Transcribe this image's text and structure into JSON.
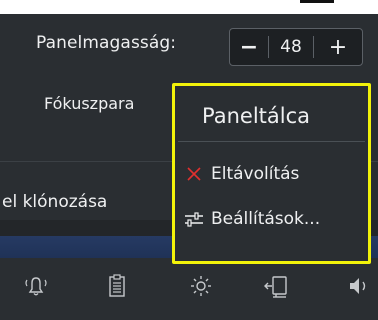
{
  "settings": {
    "panel_height_label": "Panelmagasság:",
    "panel_height_value": "48",
    "minus_label": "−",
    "plus_label": "+",
    "focus_label": "Fókuszpara",
    "clone_label": "el klónozása"
  },
  "context_menu": {
    "title": "Paneltálca",
    "items": [
      {
        "label": "Eltávolítás",
        "icon": "close-x-icon"
      },
      {
        "label": "Beállítások...",
        "icon": "configure-sliders-icon"
      }
    ],
    "highlight_color": "#f2f20a",
    "remove_icon_color": "#e0302f"
  },
  "taskbar": {
    "tray_icons": [
      "notifications-bell-icon",
      "clipboard-icon",
      "brightness-icon",
      "network-icon",
      "volume-icon"
    ]
  }
}
